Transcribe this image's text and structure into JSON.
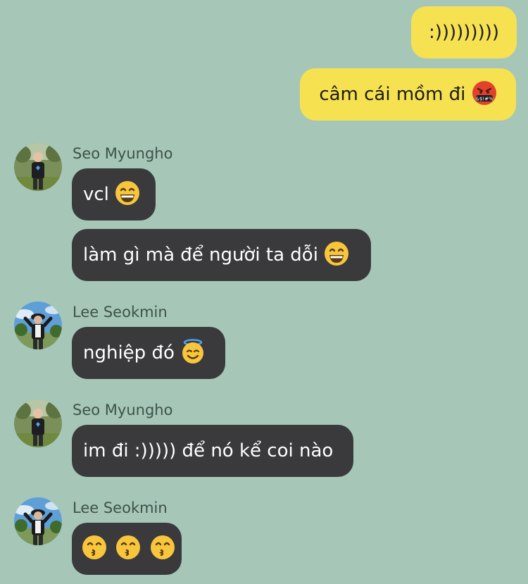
{
  "messages": {
    "m1": {
      "text": ":)))))))))"
    },
    "m2": {
      "text": "câm cái mồm đi",
      "emoji": "face-with-symbols-on-mouth"
    },
    "g1": {
      "sender": "Seo Myungho"
    },
    "m3": {
      "text": "vcl",
      "emoji": "grinning-face-with-smiling-eyes"
    },
    "m4": {
      "text": "làm gì mà để người ta dỗi",
      "emoji": "grinning-face-with-smiling-eyes"
    },
    "g2": {
      "sender": "Lee Seokmin"
    },
    "m5": {
      "text": "nghiệp đó",
      "emoji": "smiling-face-with-halo"
    },
    "g3": {
      "sender": "Seo Myungho"
    },
    "m6": {
      "text": "im đi :))))) để nó kể coi nào"
    },
    "g4": {
      "sender": "Lee Seokmin"
    },
    "m7": {
      "emojis": [
        "kissing-face",
        "kissing-face",
        "kissing-face"
      ]
    }
  },
  "colors": {
    "background": "#a6c7b8",
    "outgoing_bubble": "#f6e250",
    "incoming_bubble": "#3a3a3c",
    "incoming_text": "#ffffff",
    "sender_name": "#3f5149"
  }
}
